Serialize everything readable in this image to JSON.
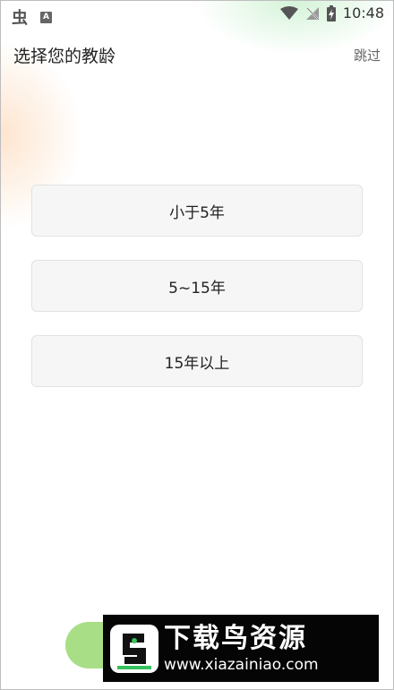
{
  "status_bar": {
    "app_icon_glyph": "虫",
    "notification_icon_glyph": "A",
    "time": "10:48",
    "icons": [
      "app-notification-icon",
      "font-notification-icon",
      "wifi-icon",
      "signal-off-icon",
      "battery-charging-icon"
    ]
  },
  "header": {
    "title": "选择您的教龄",
    "skip_label": "跳过"
  },
  "options": [
    {
      "label": "小于5年"
    },
    {
      "label": "5~15年"
    },
    {
      "label": "15年以上"
    }
  ],
  "watermark": {
    "name": "下载鸟资源",
    "url": "www.xiazainiao.com"
  },
  "colors": {
    "next_button": "#a8df86",
    "option_bg": "#f6f6f6",
    "watermark_bg": "#050505",
    "accent_green": "#36c15c"
  }
}
